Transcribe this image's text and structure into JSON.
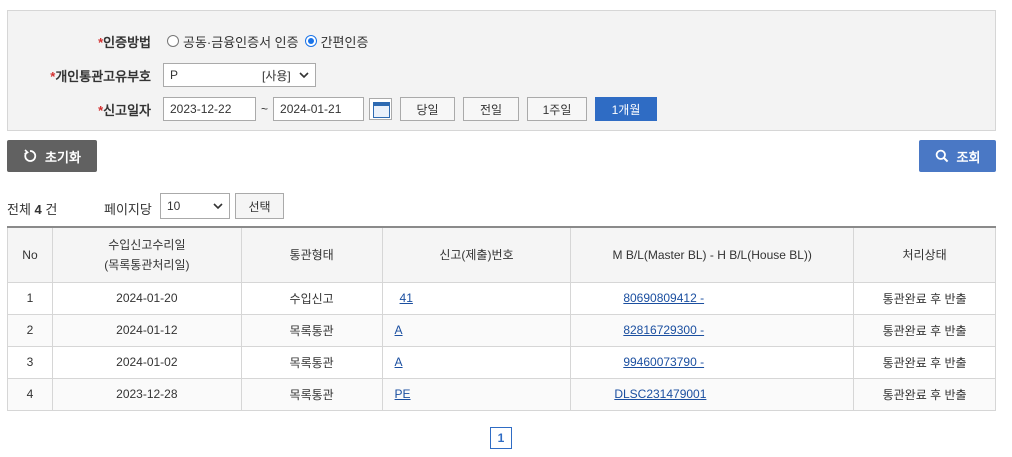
{
  "search": {
    "auth_method": {
      "label": "인증방법",
      "required_mark": "*",
      "options": [
        "공동·금융인증서 인증",
        "간편인증"
      ],
      "selected_index": 1
    },
    "customs_code": {
      "label": "개인통관고유부호",
      "required_mark": "*",
      "value": "P",
      "status": "[사용]"
    },
    "report_date": {
      "label": "신고일자",
      "required_mark": "*",
      "from": "2023-12-22",
      "separator": "~",
      "to": "2024-01-21"
    },
    "period_buttons": [
      "당일",
      "전일",
      "1주일",
      "1개월"
    ],
    "active_period_index": 3
  },
  "actions": {
    "reset_label": "초기화",
    "search_label": "조회"
  },
  "list_info": {
    "total_prefix": "전체",
    "total_count": "4",
    "total_suffix": "건",
    "per_page_label": "페이지당",
    "per_page_value": "10",
    "choose_label": "선택"
  },
  "table": {
    "headers": [
      "No",
      "수입신고수리일\n(목록통관처리일)",
      "통관형태",
      "신고(제출)번호",
      "M B/L(Master BL) - H B/L(House BL))",
      "처리상태"
    ],
    "rows": [
      {
        "no": "1",
        "date": "2024-01-20",
        "type": "수입신고",
        "report_no": "41",
        "bl": "80690809412 -",
        "status": "통관완료 후 반출"
      },
      {
        "no": "2",
        "date": "2024-01-12",
        "type": "목록통관",
        "report_no": "A",
        "bl": "82816729300 -",
        "status": "통관완료 후 반출"
      },
      {
        "no": "3",
        "date": "2024-01-02",
        "type": "목록통관",
        "report_no": "A",
        "bl": "99460073790 -",
        "status": "통관완료 후 반출"
      },
      {
        "no": "4",
        "date": "2023-12-28",
        "type": "목록통관",
        "report_no": "PE",
        "bl": "DLSC231479001",
        "status": "통관완료 후 반출"
      }
    ]
  },
  "pagination": {
    "current": "1"
  },
  "colors": {
    "primary": "#2f6cc4",
    "search_button": "#4a78c5",
    "reset_button": "#616161",
    "required": "#d32f2f",
    "link": "#1b4fa0"
  }
}
